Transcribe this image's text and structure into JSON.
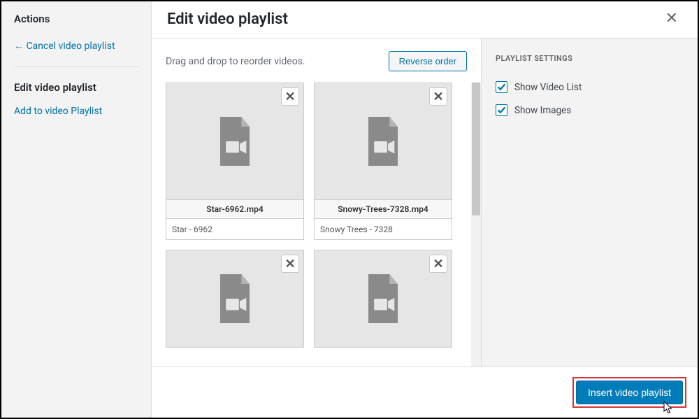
{
  "sidebar": {
    "title": "Actions",
    "cancel": "← Cancel video playlist",
    "edit_heading": "Edit video playlist",
    "add_link": "Add to video Playlist"
  },
  "header": {
    "title": "Edit video playlist"
  },
  "toolbar": {
    "hint": "Drag and drop to reorder videos.",
    "reverse": "Reverse order"
  },
  "videos": [
    {
      "filename": "Star-6962.mp4",
      "caption": "Star - 6962"
    },
    {
      "filename": "Snowy-Trees-7328.mp4",
      "caption": "Snowy Trees - 7328"
    },
    {
      "filename": "",
      "caption": ""
    },
    {
      "filename": "",
      "caption": ""
    }
  ],
  "settings": {
    "title": "PLAYLIST SETTINGS",
    "show_video_list": {
      "label": "Show Video List",
      "checked": true
    },
    "show_images": {
      "label": "Show Images",
      "checked": true
    }
  },
  "footer": {
    "insert": "Insert video playlist"
  }
}
